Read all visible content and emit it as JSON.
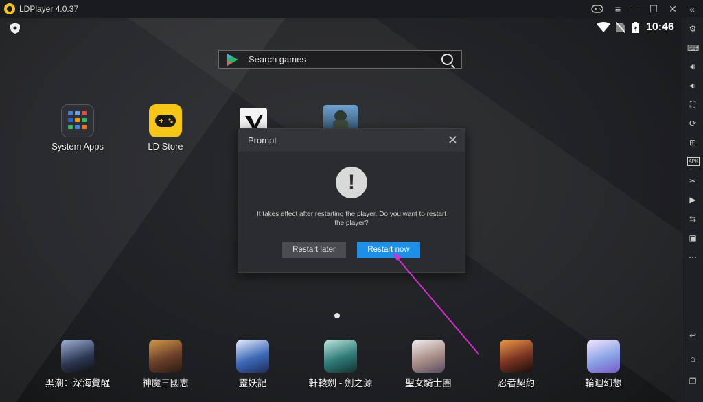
{
  "window": {
    "title": "LDPlayer 4.0.37",
    "controls": [
      "gamepad-icon",
      "menu-icon",
      "minimize-icon",
      "maximize-icon",
      "close-icon",
      "collapse-icon"
    ]
  },
  "statusbar": {
    "time": "10:46"
  },
  "search": {
    "placeholder": "Search games"
  },
  "apps": [
    {
      "label": "System Apps"
    },
    {
      "label": "LD Store"
    }
  ],
  "dock": [
    {
      "label": "黑潮：深海覺醒",
      "color": "#3a4a68"
    },
    {
      "label": "神魔三國志",
      "color": "#6b3f2a"
    },
    {
      "label": "靈妖記",
      "color": "#3d69b8"
    },
    {
      "label": "軒轅劍 - 劍之源",
      "color": "#2f7b78"
    },
    {
      "label": "聖女騎士團",
      "color": "#a98f86"
    },
    {
      "label": "忍者契約",
      "color": "#7a3322"
    },
    {
      "label": "輪迴幻想",
      "color": "#8aa3e6"
    }
  ],
  "dialog": {
    "title": "Prompt",
    "message": "It takes effect after restarting the player. Do you want to restart the player?",
    "button_later": "Restart later",
    "button_now": "Restart now"
  },
  "colors": {
    "accent": "#1e8fe6",
    "annotation": "#d12fd1"
  }
}
